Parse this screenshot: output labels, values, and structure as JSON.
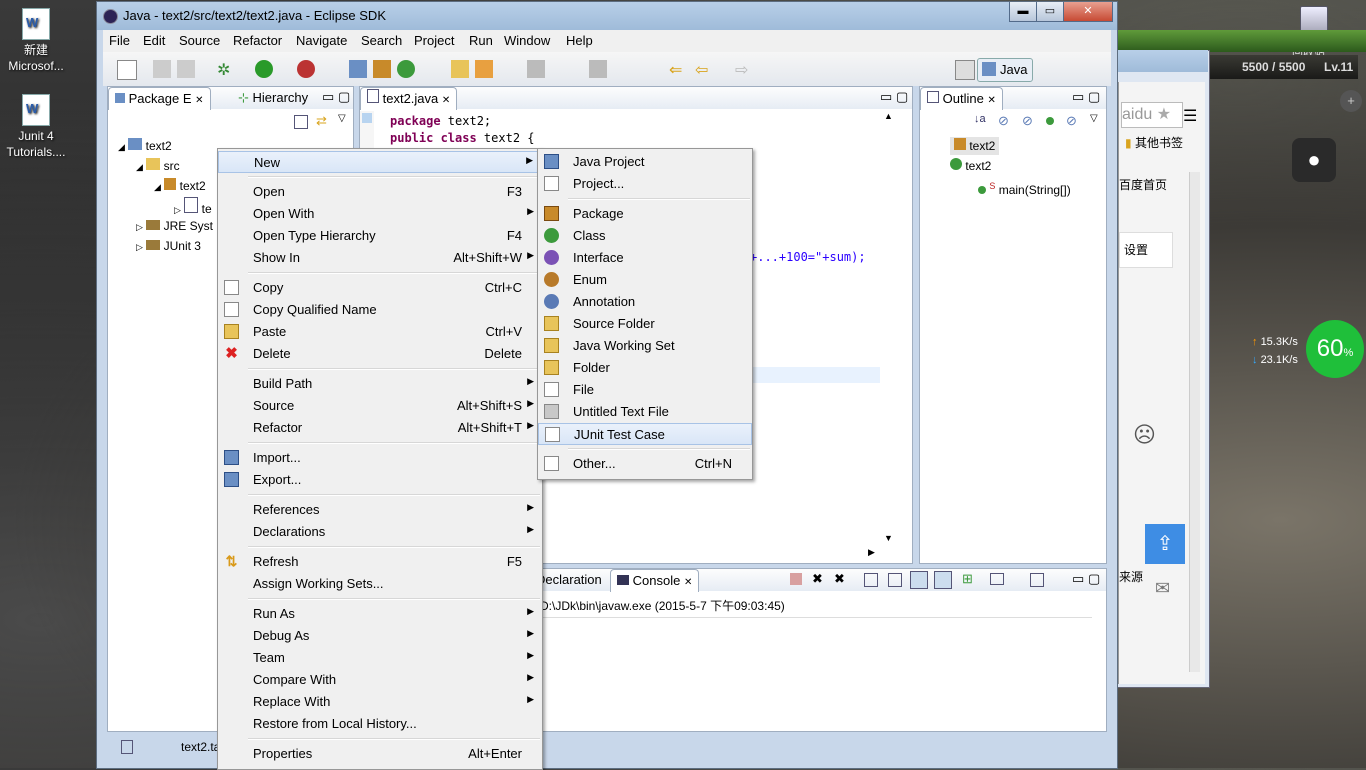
{
  "desktop": {
    "icons": [
      {
        "label_line1": "新建",
        "label_line2": "Microsof..."
      },
      {
        "label_line1": "Junit 4",
        "label_line2": "Tutorials...."
      }
    ],
    "recycle_label": "回收站"
  },
  "game_overlay": {
    "hp": "5500 / 5500",
    "level": "Lv.11"
  },
  "window": {
    "title": "Java - text2/src/text2/text2.java - Eclipse SDK",
    "controls": {
      "minimize": "▬",
      "maximize": "▭",
      "close": "✕"
    }
  },
  "menubar": [
    "File",
    "Edit",
    "Source",
    "Refactor",
    "Navigate",
    "Search",
    "Project",
    "Run",
    "Window",
    "Help"
  ],
  "perspective": {
    "label": "Java"
  },
  "package_explorer": {
    "tabs": [
      "Package E",
      "Hierarchy"
    ],
    "tree": [
      {
        "label": "text2"
      },
      {
        "label": "src"
      },
      {
        "label": "text2"
      },
      {
        "label": "te"
      },
      {
        "label": "JRE Syst"
      },
      {
        "label": "JUnit 3"
      }
    ],
    "status_file": "text2.ta"
  },
  "editor": {
    "tab": "text2.java",
    "lines": [
      {
        "kw": "package",
        "rest": " text2;"
      },
      {
        "kw": "public class",
        "rest": " text2 {"
      }
    ],
    "visible_fragment": "+...+100=\"+sum);"
  },
  "outline": {
    "tab": "Outline",
    "items": [
      {
        "label": "text2"
      },
      {
        "label": "text2"
      },
      {
        "label": "main(String[])",
        "modifier": "S"
      }
    ]
  },
  "console": {
    "tabs": [
      "Declaration",
      "Console"
    ],
    "launch": "D:\\JDk\\bin\\javaw.exe (2015-5-7 下午09:03:45)"
  },
  "context_menu": {
    "items": [
      {
        "label": "New",
        "submenu": true,
        "highlight": true
      },
      {
        "label": "Open",
        "shortcut": "F3"
      },
      {
        "label": "Open With",
        "submenu": true
      },
      {
        "label": "Open Type Hierarchy",
        "shortcut": "F4"
      },
      {
        "label": "Show In",
        "shortcut": "Alt+Shift+W",
        "submenu": true
      },
      {
        "label": "Copy",
        "shortcut": "Ctrl+C"
      },
      {
        "label": "Copy Qualified Name"
      },
      {
        "label": "Paste",
        "shortcut": "Ctrl+V"
      },
      {
        "label": "Delete",
        "shortcut": "Delete"
      },
      {
        "label": "Build Path",
        "submenu": true
      },
      {
        "label": "Source",
        "shortcut": "Alt+Shift+S",
        "submenu": true
      },
      {
        "label": "Refactor",
        "shortcut": "Alt+Shift+T",
        "submenu": true
      },
      {
        "label": "Import..."
      },
      {
        "label": "Export..."
      },
      {
        "label": "References",
        "submenu": true
      },
      {
        "label": "Declarations",
        "submenu": true
      },
      {
        "label": "Refresh",
        "shortcut": "F5"
      },
      {
        "label": "Assign Working Sets..."
      },
      {
        "label": "Run As",
        "submenu": true
      },
      {
        "label": "Debug As",
        "submenu": true
      },
      {
        "label": "Team",
        "submenu": true
      },
      {
        "label": "Compare With",
        "submenu": true
      },
      {
        "label": "Replace With",
        "submenu": true
      },
      {
        "label": "Restore from Local History..."
      },
      {
        "label": "Properties",
        "shortcut": "Alt+Enter"
      }
    ]
  },
  "new_submenu": {
    "items": [
      {
        "label": "Java Project"
      },
      {
        "label": "Project..."
      },
      {
        "label": "Package"
      },
      {
        "label": "Class"
      },
      {
        "label": "Interface"
      },
      {
        "label": "Enum"
      },
      {
        "label": "Annotation"
      },
      {
        "label": "Source Folder"
      },
      {
        "label": "Java Working Set"
      },
      {
        "label": "Folder"
      },
      {
        "label": "File"
      },
      {
        "label": "Untitled Text File"
      },
      {
        "label": "JUnit Test Case",
        "highlight": true
      },
      {
        "label": "Other...",
        "shortcut": "Ctrl+N"
      }
    ]
  },
  "browser": {
    "logo_fragment": "aidu",
    "bookmark": "其他书签",
    "home": "百度首页",
    "settings": "设置",
    "source_fragment": "来源"
  },
  "network_widget": {
    "up": "15.3K/s",
    "down": "23.1K/s",
    "percent": "60",
    "percent_sign": "%"
  },
  "colors": {
    "highlight": "#d9e6f7",
    "titlebar": "#9fbbd9",
    "keyword": "#7f0055"
  }
}
